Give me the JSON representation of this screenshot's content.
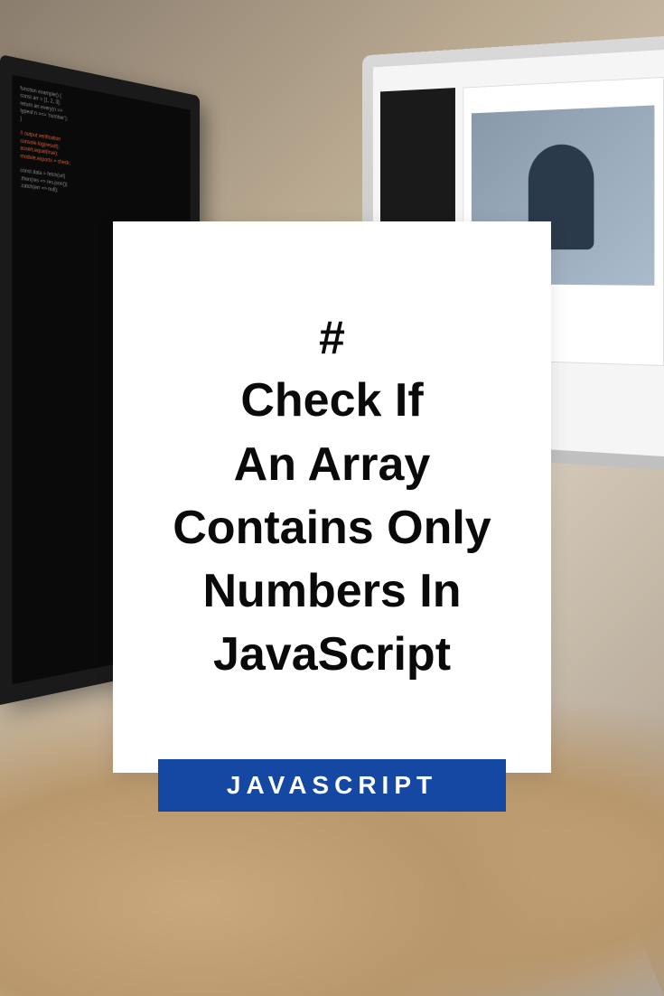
{
  "card": {
    "hash": "#",
    "title": "Check If\nAn Array\nContains Only\nNumbers In\nJavaScript"
  },
  "badge": {
    "category": "JAVASCRIPT"
  }
}
